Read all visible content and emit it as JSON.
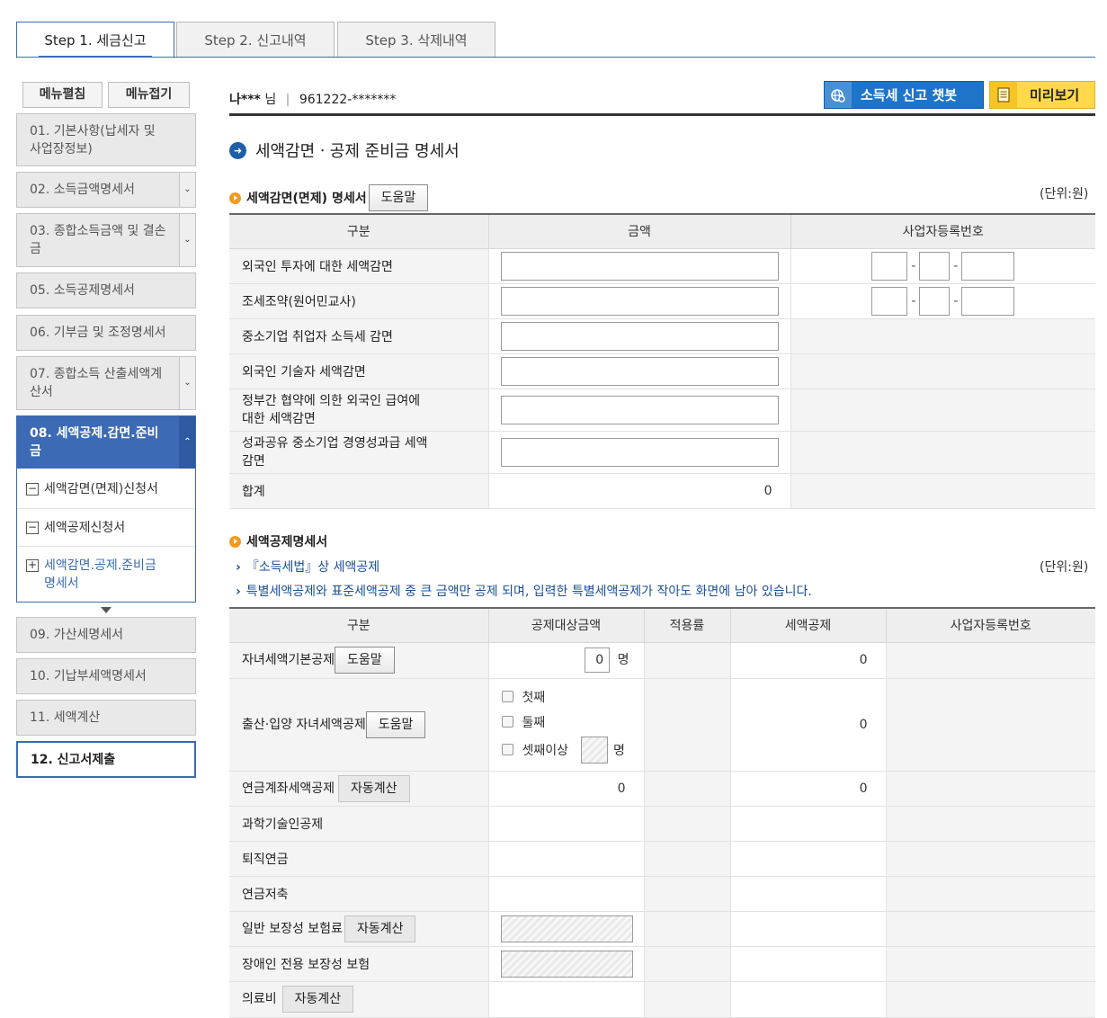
{
  "tabs": [
    "Step 1. 세금신고",
    "Step 2. 신고내역",
    "Step 3. 삭제내역"
  ],
  "sidebar": {
    "expand_label": "메뉴펼침",
    "collapse_label": "메뉴접기",
    "items": [
      {
        "label": "01. 기본사항(납세자 및\n사업장정보)"
      },
      {
        "label": "02. 소득금액명세서"
      },
      {
        "label": "03. 종합소득금액 및 결손\n금"
      },
      {
        "label": "05. 소득공제명세서"
      },
      {
        "label": "06. 기부금 및 조정명세서"
      },
      {
        "label": "07. 종합소득 산출세액계\n산서"
      },
      {
        "label": "08. 세액공제.감면.준비\n금"
      },
      {
        "label": "09. 가산세명세서"
      },
      {
        "label": "10. 기납부세액명세서"
      },
      {
        "label": "11. 세액계산"
      },
      {
        "label": "12. 신고서제출"
      }
    ],
    "subitems": [
      {
        "label": "세액감면(면제)신청서",
        "icon": "minus-box"
      },
      {
        "label": "세액공제신청서",
        "icon": "minus-box"
      },
      {
        "label": "세액감면.공제.준비금\n명세서",
        "icon": "plus-box"
      }
    ]
  },
  "header": {
    "user_name": "나***",
    "honorific": "님",
    "separator": "|",
    "id_masked": "961222-*******",
    "chatbot_label": "소득세 신고 챗봇",
    "preview_label": "미리보기"
  },
  "page_title": "세액감면ㆍ공제 준비금 명세서",
  "section1": {
    "title": "세액감면(면제) 명세서",
    "help_label": "도움말",
    "unit": "(단위:원)",
    "headers": [
      "구분",
      "금액",
      "사업자등록번호"
    ],
    "rows": [
      {
        "label": "외국인 투자에 대한 세액감면"
      },
      {
        "label": "조세조약(원어민교사)"
      },
      {
        "label": "중소기업 취업자 소득세 감면"
      },
      {
        "label": "외국인 기술자 세액감면"
      },
      {
        "label": "정부간 협약에 의한 외국인 급여에\n대한 세액감면"
      },
      {
        "label": "성과공유 중소기업 경영성과급 세액\n감면"
      }
    ],
    "total_label": "합계",
    "total_value": "0",
    "biz_dash": "-"
  },
  "section2": {
    "title": "세액공제명세서",
    "note1": "『소득세법』상 세액공제",
    "note2": "특별세액공제와 표준세액공제 중 큰 금액만 공제 되며, 입력한 특별세액공제가 작아도 화면에 남아 있습니다.",
    "unit": "(단위:원)",
    "headers": [
      "구분",
      "공제대상금액",
      "적용률",
      "세액공제",
      "사업자등록번호"
    ],
    "child_label": "자녀세액기본공제",
    "child_count": "0",
    "count_unit": "명",
    "child_credit": "0",
    "birth_label": "출산·입양 자녀세액공제",
    "birth_options": [
      "첫째",
      "둘째",
      "셋째이상"
    ],
    "birth_credit": "0",
    "pension_label": "연금계좌세액공제",
    "pension_amount": "0",
    "pension_credit": "0",
    "science_label": "과학기술인공제",
    "retire_label": "퇴직연금",
    "savings_label": "연금저축",
    "insurance_label": "일반 보장성 보험료",
    "disabled_ins_label": "장애인 전용 보장성 보험",
    "medical_label": "의료비",
    "help_label": "도움말",
    "auto_label": "자동계산"
  },
  "colors": {
    "accent": "#3c6ab5",
    "chatbot_bg": "#1e74c8",
    "preview_bg": "#ffd94a",
    "section_dot": "#f39a1e"
  }
}
